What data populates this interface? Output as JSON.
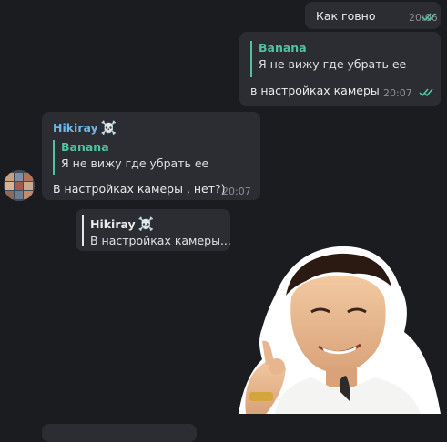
{
  "messages": [
    {
      "text": "Как говно",
      "time": "20:06"
    },
    {
      "reply_name": "Banana",
      "reply_text": "Я не вижу где убрать ее",
      "text": "в настройках камеры",
      "time": "20:07"
    },
    {
      "sender": "Hikiray",
      "sender_emoji": "☠️",
      "reply_name": "Banana",
      "reply_text": "Я не вижу где убрать ее",
      "text": "В настройках камеры , нет?)",
      "time": "20:07"
    },
    {
      "reply_name": "Hikiray",
      "reply_emoji": "☠️",
      "reply_text": "В настройках камеры..."
    }
  ],
  "colors": {
    "background": "#1b1c1f",
    "bubble": "#2b2d32",
    "reply_accent": "#4fc3a1",
    "sender_name": "#6cb6e8",
    "read_check": "#4fc3a1",
    "time": "#8a8f96"
  },
  "icons": {
    "read_status": "double-check-icon",
    "avatar": "avatar",
    "sticker": "sticker-image"
  }
}
